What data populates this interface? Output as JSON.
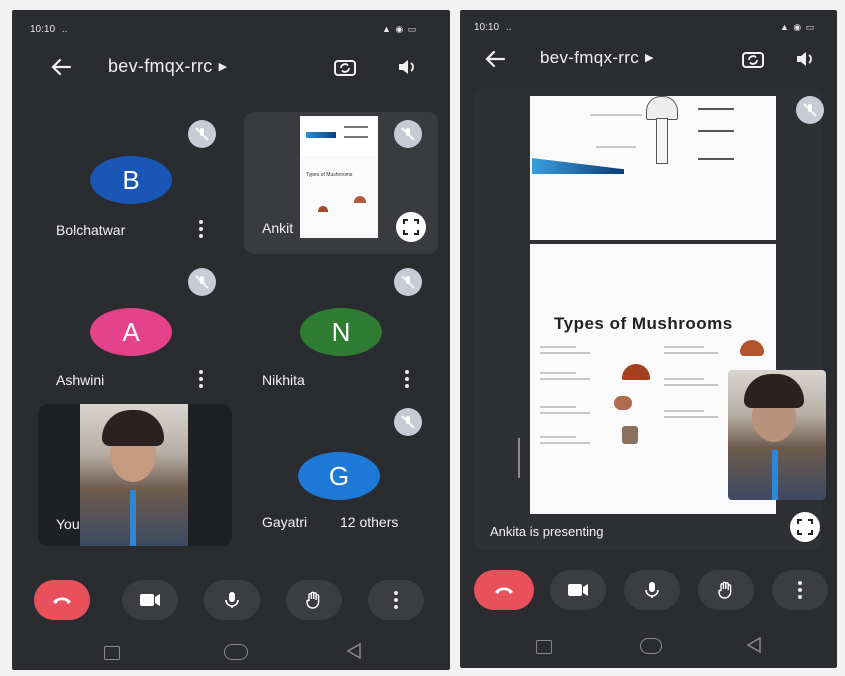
{
  "left": {
    "status": {
      "time": "10:10",
      "signal": "..",
      "icons": "▲ ◉ ▭"
    },
    "meeting_code": "bev-fmqx-rrc",
    "participants": [
      {
        "initial": "B",
        "name": "Bolchatwar",
        "color": "#1a56b6"
      },
      {
        "initial": "",
        "name": "Ankit"
      },
      {
        "initial": "A",
        "name": "Ashwini",
        "color": "#e4438c"
      },
      {
        "initial": "N",
        "name": "Nikhita",
        "color": "#2f7d32"
      },
      {
        "initial": "",
        "name": "You"
      },
      {
        "initial": "G",
        "name": "Gayatri",
        "color": "#1e78d6",
        "extra": "12 others"
      }
    ],
    "thumb_slide_title": "Types of Mushrooms"
  },
  "right": {
    "status": {
      "time": "10:10",
      "signal": "..",
      "icons": "▲ ◉ ▭"
    },
    "meeting_code": "bev-fmqx-rrc",
    "slide_title": "Types of Mushrooms",
    "presenting_label": "Ankita is presenting"
  },
  "colors": {
    "bg": "#2b2c2f",
    "tile": "#323337",
    "end_call": "#e8505c",
    "control": "#3c3d41"
  }
}
